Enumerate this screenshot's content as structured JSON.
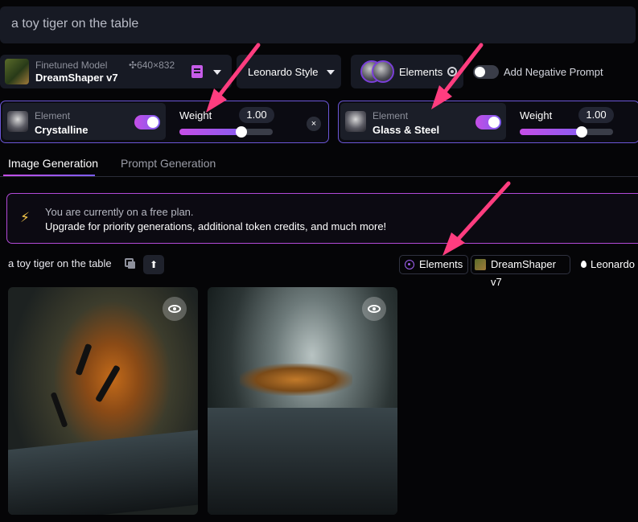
{
  "prompt": {
    "text": "a toy tiger on the table"
  },
  "model": {
    "label": "Finetuned Model",
    "size": "640×832",
    "size_icon": "size-cross-icon",
    "name": "DreamShaper v7"
  },
  "style_select": {
    "value": "Leonardo Style"
  },
  "elements_button": {
    "label": "Elements"
  },
  "negative_prompt": {
    "label": "Add Negative Prompt",
    "enabled": false
  },
  "elements": [
    {
      "kind": "Element",
      "name": "Crystalline",
      "enabled": true,
      "weight_label": "Weight",
      "weight": "1.00",
      "weight_fraction": 0.66
    },
    {
      "kind": "Element",
      "name": "Glass & Steel",
      "enabled": true,
      "weight_label": "Weight",
      "weight": "1.00",
      "weight_fraction": 0.66
    }
  ],
  "close_icon": "×",
  "tabs": [
    {
      "label": "Image Generation",
      "active": true
    },
    {
      "label": "Prompt Generation",
      "active": false
    }
  ],
  "banner": {
    "icon": "⚡",
    "line1": "You are currently on a free plan.",
    "line2": "Upgrade for priority generations, additional token credits, and much more!"
  },
  "generation": {
    "prompt": "a toy tiger on the table",
    "up_icon": "⬆",
    "tag_elements": "Elements",
    "tag_model": "DreamShaper v7",
    "tag_style": "Leonardo"
  },
  "colors": {
    "accent_purple": "#7c5cf0",
    "accent_pink": "#c54ee6",
    "arrow_pink": "#ff3d7f",
    "background": "#050507"
  }
}
